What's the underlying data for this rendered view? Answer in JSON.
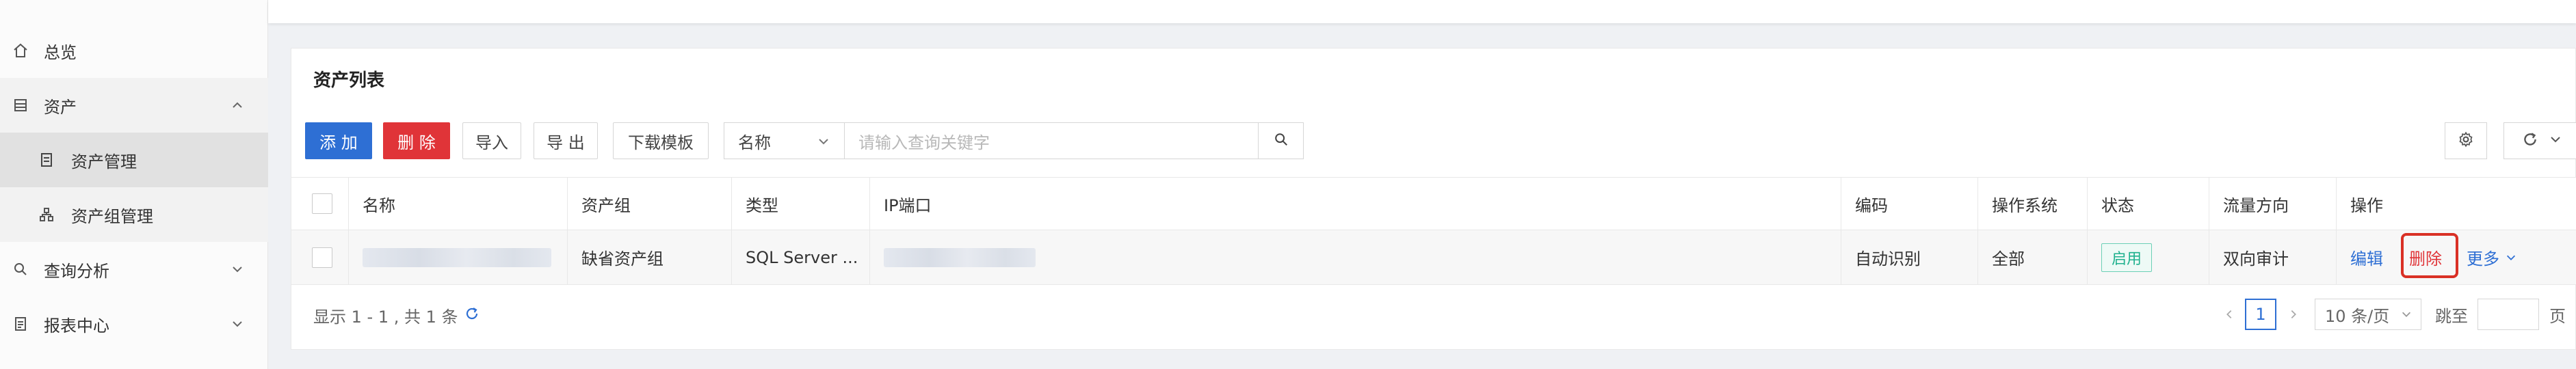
{
  "sidebar": {
    "items": [
      {
        "label": "总览",
        "icon": "home-icon"
      },
      {
        "label": "资产",
        "icon": "asset-icon",
        "expanded": true
      },
      {
        "label": "资产管理",
        "icon": "list-icon",
        "active": true
      },
      {
        "label": "资产组管理",
        "icon": "group-icon"
      },
      {
        "label": "查询分析",
        "icon": "search-analysis-icon"
      },
      {
        "label": "报表中心",
        "icon": "report-icon"
      }
    ]
  },
  "card": {
    "title": "资产列表"
  },
  "toolbar": {
    "add_label": "添 加",
    "delete_label": "删 除",
    "import_label": "导入",
    "export_label": "导 出",
    "template_label": "下载模板",
    "search_field": "名称",
    "search_placeholder": "请输入查询关键字"
  },
  "table": {
    "headers": [
      "名称",
      "资产组",
      "类型",
      "IP端口",
      "编码",
      "操作系统",
      "状态",
      "流量方向",
      "操作"
    ],
    "rows": [
      {
        "name": "",
        "group": "缺省资产组",
        "type": "SQL Server ...",
        "ip_port": "",
        "encoding": "自动识别",
        "os": "全部",
        "status": "启用",
        "direction": "双向审计",
        "actions": {
          "edit": "编辑",
          "delete": "删除",
          "more": "更多"
        }
      }
    ]
  },
  "footer": {
    "summary": "显示 1 - 1 , 共 1 条",
    "current_page": "1",
    "page_size": "10 条/页",
    "jump_label": "跳至",
    "page_suffix": "页"
  },
  "colors": {
    "primary": "#2e6fd4",
    "danger": "#e03438",
    "status_green": "#20b18e"
  }
}
